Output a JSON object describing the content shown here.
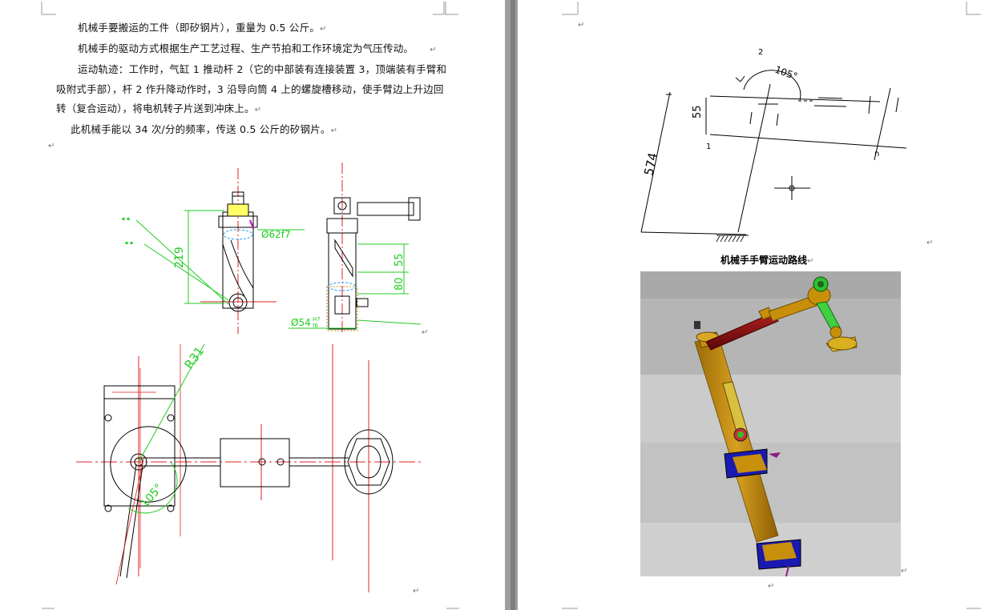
{
  "left_page": {
    "paragraphs": [
      {
        "text": "机械手要搬运的工件（即矽钢片），重量为 0.5 公斤。",
        "mark": "↵"
      },
      {
        "text": "机械手的驱动方式根据生产工艺过程、生产节拍和工作环境定为气压传动。",
        "mark": "↵"
      },
      {
        "text": "运动轨迹：工作时，气缸 1 推动杆 2（它的中部装有连接装置 3，顶端装有手臂和",
        "mark": ""
      },
      {
        "text": "吸附式手部），杆 2 作升降动作时，3 沿导向筒 4 上的螺旋槽移动，使手臂边上升边回",
        "mark": ""
      },
      {
        "text": "转（复合运动），将电机转子片送到冲床上。",
        "mark": "↵"
      },
      {
        "text": "此机械手能以 34 次/分的频率，传送 0.5 公斤的矽钢片。",
        "mark": "↵"
      }
    ],
    "empty_mark": "↵",
    "drawing_marks": [
      "↵",
      "↵"
    ],
    "dimensions": {
      "d1": "Ø62f7",
      "d2": "219",
      "d3": "55",
      "d4": "80",
      "d5": "Ø54",
      "d5_tol_upper": "H7",
      "d5_tol_lower": "f6",
      "d6": "R31",
      "d7": "105°"
    }
  },
  "right_page": {
    "top_mark": "↵",
    "diagram_labels": {
      "point2": "2",
      "angle": "105°",
      "height_55": "55",
      "point1": "1",
      "height_574": "574",
      "point_n": "n"
    },
    "diagram_mark": "↵",
    "caption": "机械手手臂运动路线",
    "caption_mark": "↵",
    "render_mark": "↵",
    "bottom_mark": "↵"
  },
  "colors": {
    "gutter": "#9e9e9e",
    "cad_red": "#e02020",
    "cad_green": "#22cc22",
    "arm_gold": "#c8900a",
    "arm_red": "#8b1010",
    "base_blue": "#1a1ab0",
    "render_bg": "#bdbdbd"
  }
}
